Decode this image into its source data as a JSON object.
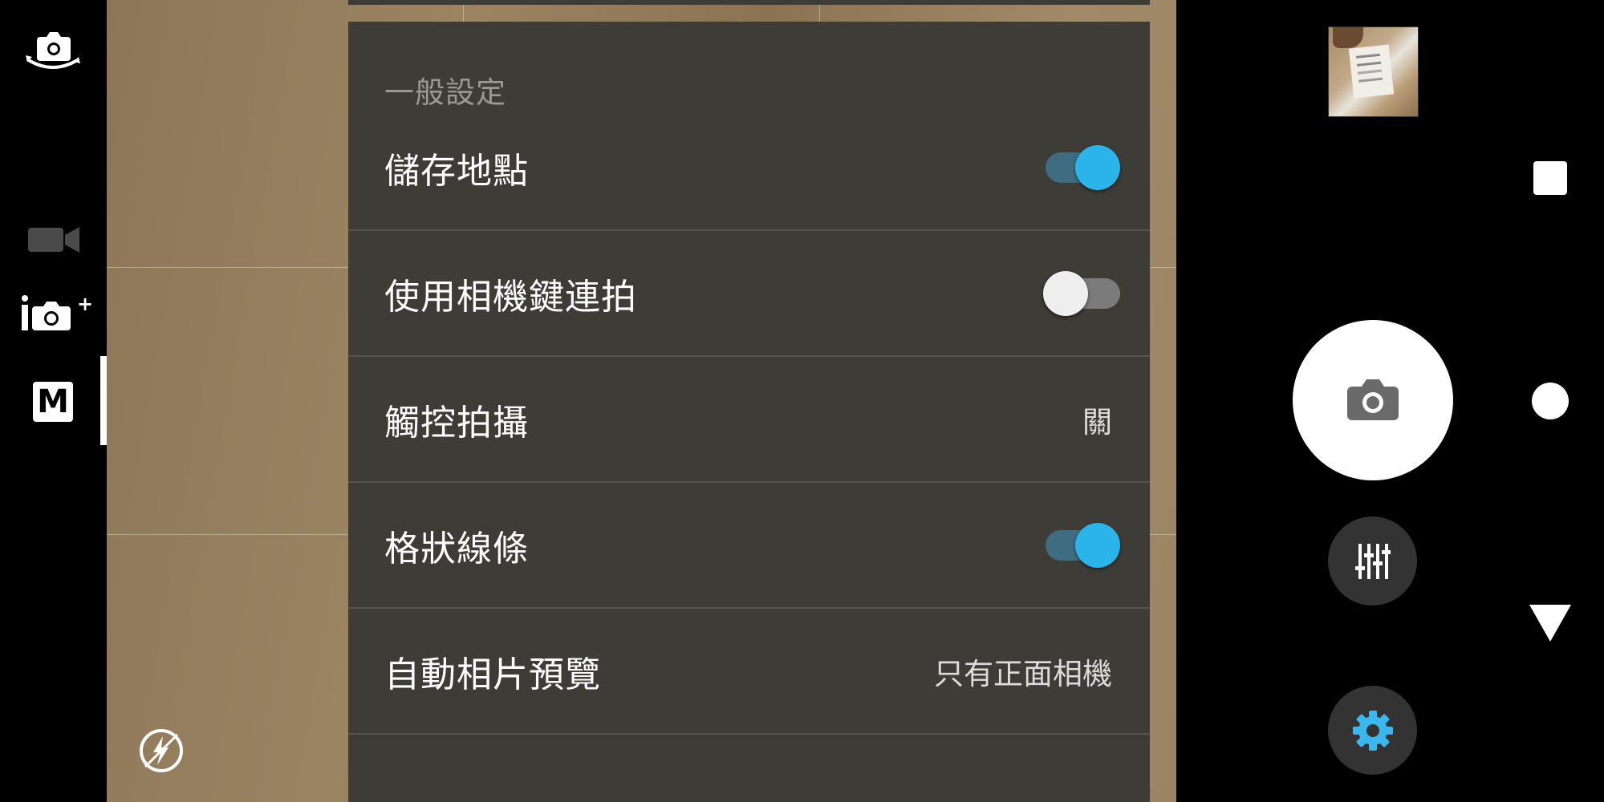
{
  "settings": {
    "section_title": "一般設定",
    "rows": [
      {
        "label": "儲存地點",
        "type": "toggle",
        "state": "on"
      },
      {
        "label": "使用相機鍵連拍",
        "type": "toggle",
        "state": "off"
      },
      {
        "label": "觸控拍攝",
        "type": "value",
        "value": "關"
      },
      {
        "label": "格狀線條",
        "type": "toggle",
        "state": "on"
      },
      {
        "label": "自動相片預覽",
        "type": "value",
        "value": "只有正面相機"
      }
    ]
  },
  "left_rail": {
    "icons": [
      "switch-camera-icon",
      "video-mode-icon",
      "superior-auto-icon",
      "manual-mode-icon",
      "flash-auto-icon"
    ],
    "manual_mode_letter": "M",
    "auto_superscript": "+"
  },
  "right_panel": {
    "icons": [
      "last-photo-thumbnail",
      "shutter-camera-icon",
      "adjustments-icon",
      "settings-gear-icon"
    ]
  },
  "nav_bar": {
    "icons": [
      "recent-apps-icon",
      "home-icon",
      "back-icon"
    ]
  },
  "colors": {
    "toggle_on": "#2ab4e9",
    "toggle_on_track": "#3f6c80",
    "panel_bg": "#3d3c37",
    "settings_gear": "#3ab7ec"
  }
}
